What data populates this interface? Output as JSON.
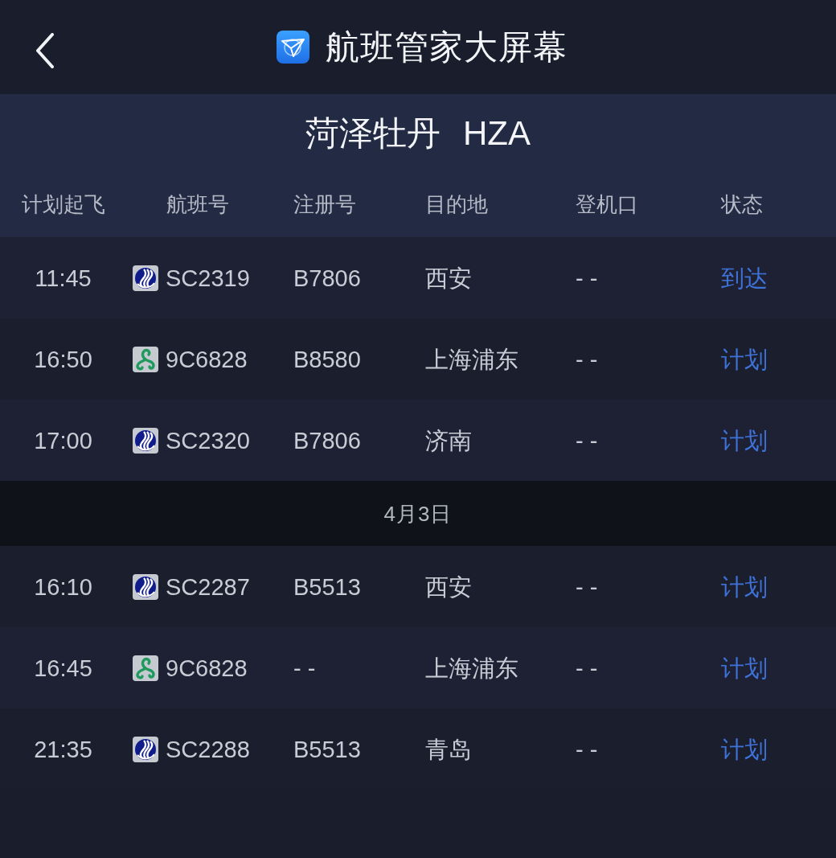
{
  "top_bar": {
    "title": "航班管家大屏幕"
  },
  "station": {
    "name": "菏泽牡丹",
    "code": "HZA"
  },
  "table": {
    "columns": [
      "计划起飞",
      "航班号",
      "注册号",
      "目的地",
      "登机口",
      "状态"
    ],
    "sections": [
      {
        "rows": [
          {
            "time": "11:45",
            "kind": "wave",
            "flight": "SC2319",
            "registration": "B7806",
            "destination": "西安",
            "gate": "- -",
            "status": "到达"
          },
          {
            "time": "16:50",
            "kind": "trefoil",
            "flight": "9C6828",
            "registration": "B8580",
            "destination": "上海浦东",
            "gate": "- -",
            "status": "计划"
          },
          {
            "time": "17:00",
            "kind": "wave",
            "flight": "SC2320",
            "registration": "B7806",
            "destination": "济南",
            "gate": "- -",
            "status": "计划"
          }
        ]
      },
      {
        "date": "4月3日",
        "rows": [
          {
            "time": "16:10",
            "kind": "wave",
            "flight": "SC2287",
            "registration": "B5513",
            "destination": "西安",
            "gate": "- -",
            "status": "计划"
          },
          {
            "time": "16:45",
            "kind": "trefoil",
            "flight": "9C6828",
            "registration": "- -",
            "destination": "上海浦东",
            "gate": "- -",
            "status": "计划"
          },
          {
            "time": "21:35",
            "kind": "wave",
            "flight": "SC2288",
            "registration": "B5513",
            "destination": "青岛",
            "gate": "- -",
            "status": "计划"
          }
        ]
      }
    ]
  }
}
